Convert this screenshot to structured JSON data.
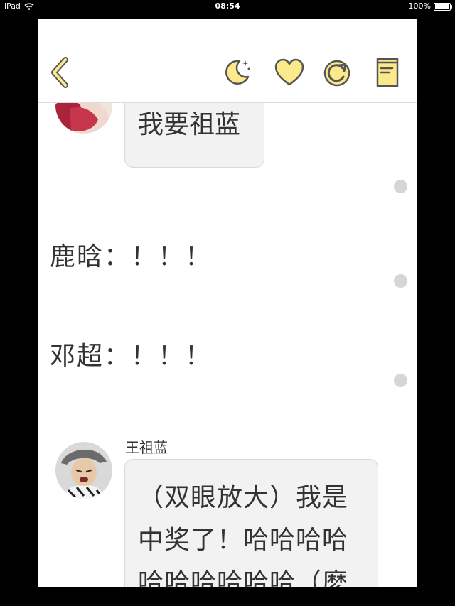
{
  "status_bar": {
    "device": "iPad",
    "time": "08:54",
    "battery": "100%"
  },
  "nav": {
    "back_icon": "chevron-left-icon",
    "night_mode_icon": "moon-icon",
    "like_icon": "heart-icon",
    "refresh_icon": "refresh-icon",
    "chapters_icon": "book-icon",
    "accent_color": "#fbe98a",
    "icon_stroke": "#555555"
  },
  "messages": [
    {
      "type": "bubble",
      "text": "我要祖蓝"
    },
    {
      "type": "narration",
      "text": "鹿晗：！！！"
    },
    {
      "type": "narration",
      "text": "邓超：！！！"
    },
    {
      "type": "bubble",
      "sender": "王祖蓝",
      "text": "（双眼放大）我是中奖了！哈哈哈哈哈哈哈哈哈哈（麽"
    }
  ]
}
